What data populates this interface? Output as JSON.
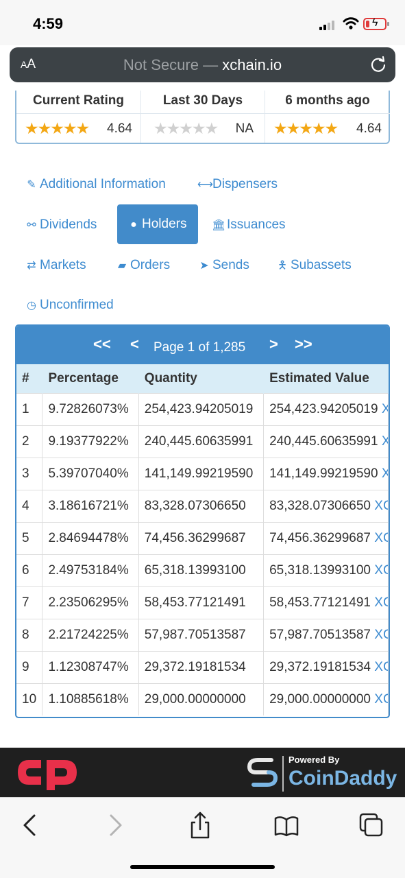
{
  "status_bar": {
    "time": "4:59"
  },
  "url_bar": {
    "aa_label": "AA",
    "security": "Not Secure",
    "separator": " — ",
    "host": "xchain.io"
  },
  "ratings": [
    {
      "header": "Current Rating",
      "stars": 4.5,
      "value": "4.64"
    },
    {
      "header": "Last 30 Days",
      "stars": 0,
      "value": "NA"
    },
    {
      "header": "6 months ago",
      "stars": 4.5,
      "value": "4.64"
    }
  ],
  "nav": {
    "additional_information": "Additional Information",
    "dispensers": "Dispensers",
    "dividends": "Dividends",
    "holders": "Holders",
    "issuances": "Issuances",
    "markets": "Markets",
    "orders": "Orders",
    "sends": "Sends",
    "subassets": "Subassets",
    "unconfirmed": "Unconfirmed"
  },
  "pager": {
    "label": "Page 1 of 1,285",
    "first": "<<",
    "prev": "<",
    "next": ">",
    "last": ">>"
  },
  "table": {
    "headers": [
      "#",
      "Percentage",
      "Quantity",
      "Estimated Value"
    ],
    "rows": [
      {
        "n": "1",
        "pct": "9.72826073%",
        "qty": "254,423.94205019",
        "val": "254,423.94205019",
        "unit": "X"
      },
      {
        "n": "2",
        "pct": "9.19377922%",
        "qty": "240,445.60635991",
        "val": "240,445.60635991",
        "unit": "X"
      },
      {
        "n": "3",
        "pct": "5.39707040%",
        "qty": "141,149.99219590",
        "val": "141,149.99219590",
        "unit": "X"
      },
      {
        "n": "4",
        "pct": "3.18616721%",
        "qty": "83,328.07306650",
        "val": "83,328.07306650",
        "unit": "XC"
      },
      {
        "n": "5",
        "pct": "2.84694478%",
        "qty": "74,456.36299687",
        "val": "74,456.36299687",
        "unit": "XC"
      },
      {
        "n": "6",
        "pct": "2.49753184%",
        "qty": "65,318.13993100",
        "val": "65,318.13993100",
        "unit": "XC"
      },
      {
        "n": "7",
        "pct": "2.23506295%",
        "qty": "58,453.77121491",
        "val": "58,453.77121491",
        "unit": "XC"
      },
      {
        "n": "8",
        "pct": "2.21724225%",
        "qty": "57,987.70513587",
        "val": "57,987.70513587",
        "unit": "XC"
      },
      {
        "n": "9",
        "pct": "1.12308747%",
        "qty": "29,372.19181534",
        "val": "29,372.19181534",
        "unit": "XC"
      },
      {
        "n": "10",
        "pct": "1.10885618%",
        "qty": "29,000.00000000",
        "val": "29,000.00000000",
        "unit": "XC"
      }
    ]
  },
  "footer": {
    "powered_by": "Powered By",
    "brand": "CoinDaddy"
  },
  "colors": {
    "link": "#3d8bd0",
    "panel": "#428bca",
    "star": "#f3a714",
    "brand_red": "#e8304a"
  },
  "toolbar_icons": [
    "back-icon",
    "forward-icon",
    "share-icon",
    "bookmarks-icon",
    "tabs-icon"
  ]
}
